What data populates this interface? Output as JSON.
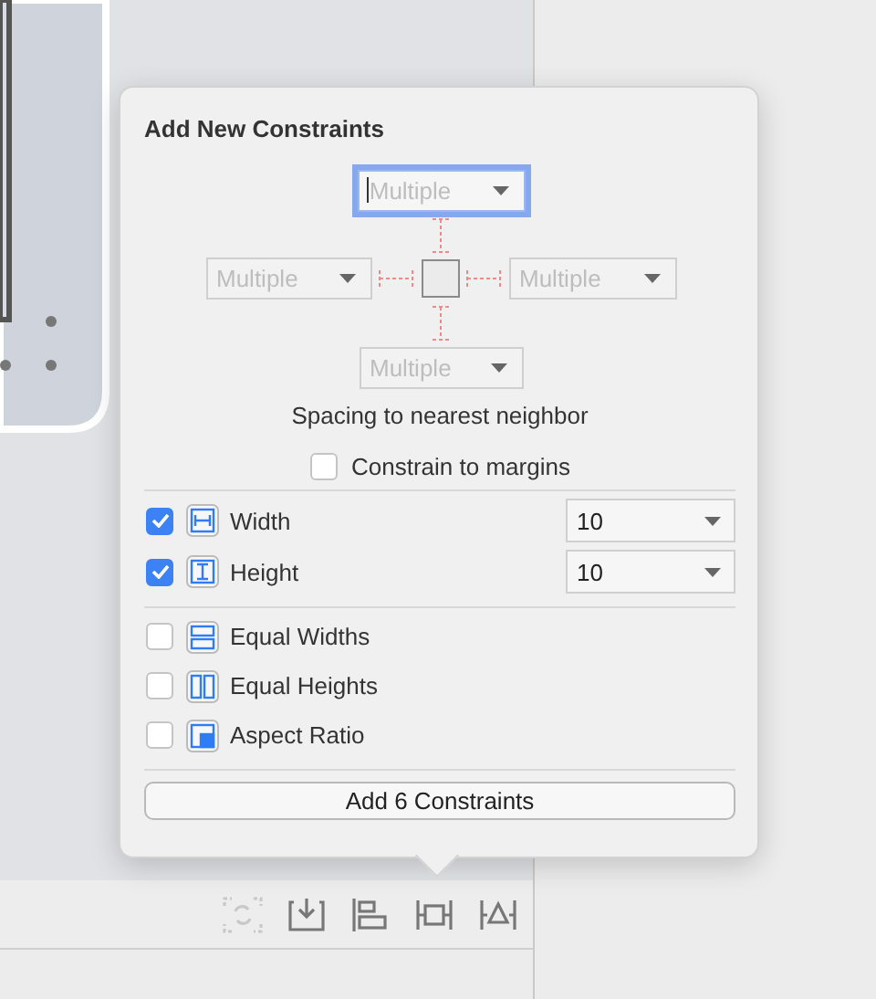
{
  "popover": {
    "title": "Add New Constraints",
    "spacing": {
      "top": {
        "placeholder": "Multiple",
        "focused": true
      },
      "left": {
        "placeholder": "Multiple",
        "focused": false
      },
      "right": {
        "placeholder": "Multiple",
        "focused": false
      },
      "bottom": {
        "placeholder": "Multiple",
        "focused": false
      }
    },
    "spacing_caption": "Spacing to nearest neighbor",
    "margins": {
      "label": "Constrain to margins",
      "checked": false
    },
    "size_rows": [
      {
        "kind": "width",
        "label": "Width",
        "checked": true,
        "value": "10"
      },
      {
        "kind": "height",
        "label": "Height",
        "checked": true,
        "value": "10"
      }
    ],
    "equal_rows": [
      {
        "kind": "equal-widths",
        "label": "Equal Widths",
        "checked": false
      },
      {
        "kind": "equal-heights",
        "label": "Equal Heights",
        "checked": false
      },
      {
        "kind": "aspect-ratio",
        "label": "Aspect Ratio",
        "checked": false
      }
    ],
    "button": "Add 6 Constraints"
  },
  "toolbar": [
    {
      "kind": "update",
      "disabled": true
    },
    {
      "kind": "embed",
      "disabled": false
    },
    {
      "kind": "align",
      "disabled": false
    },
    {
      "kind": "pin",
      "disabled": false
    },
    {
      "kind": "resolve",
      "disabled": false
    }
  ]
}
